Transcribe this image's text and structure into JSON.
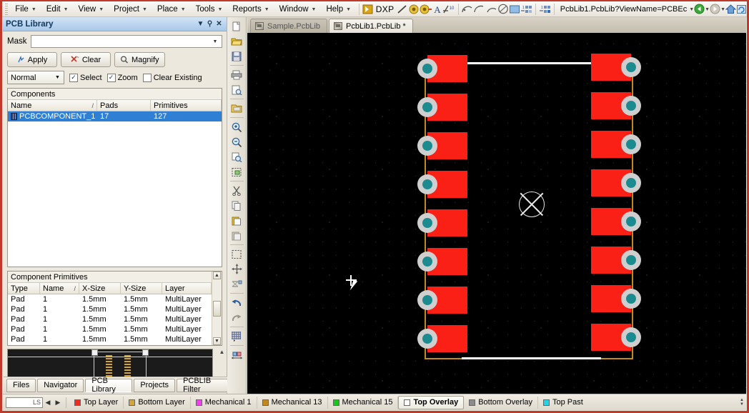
{
  "menu": {
    "items": [
      {
        "label": "File",
        "accel": "F"
      },
      {
        "label": "Edit",
        "accel": "E"
      },
      {
        "label": "View",
        "accel": "V"
      },
      {
        "label": "Project",
        "accel": "j"
      },
      {
        "label": "Place",
        "accel": "P"
      },
      {
        "label": "Tools",
        "accel": "T"
      },
      {
        "label": "Reports",
        "accel": "R"
      },
      {
        "label": "Window",
        "accel": "W"
      },
      {
        "label": "Help",
        "accel": "H"
      }
    ],
    "dxp_label": "DXP",
    "address": "PcbLib1.PcbLib?ViewName=PCBEc",
    "toolbar_icons": [
      "dxp-menu-icon",
      "line-icon",
      "pad-icon",
      "via-icon",
      "string-icon",
      "coordinate-icon",
      "arc-center-icon",
      "arc-edge-icon",
      "arc-any-icon",
      "full-circle-icon",
      "fill-icon",
      "component-body-icon",
      "dimension-icon"
    ],
    "nav_icons": [
      "back-icon",
      "forward-icon",
      "home-icon",
      "refresh-icon"
    ]
  },
  "panel": {
    "title": "PCB Library",
    "title_buttons": [
      "chevron-down-icon",
      "pin-icon",
      "close-icon"
    ],
    "mask_label": "Mask",
    "mask_value": "",
    "buttons": [
      {
        "label": "Apply",
        "icon": "apply-icon"
      },
      {
        "label": "Clear",
        "icon": "clear-icon"
      },
      {
        "label": "Magnify",
        "icon": "magnify-icon"
      }
    ],
    "select_mode": "Normal",
    "checkboxes": [
      {
        "label": "Select",
        "checked": true
      },
      {
        "label": "Zoom",
        "checked": true
      },
      {
        "label": "Clear Existing",
        "checked": false
      }
    ],
    "components": {
      "caption": "Components",
      "columns": [
        "Name",
        "Pads",
        "Primitives"
      ],
      "sorted_column": "Name",
      "rows": [
        {
          "name": "PCBCOMPONENT_1",
          "pads": "17",
          "primitives": "127",
          "selected": true
        }
      ]
    },
    "primitives": {
      "caption": "Component Primitives",
      "columns": [
        "Type",
        "Name",
        "X-Size",
        "Y-Size",
        "Layer"
      ],
      "sorted_column": "Name",
      "rows": [
        {
          "type": "Pad",
          "name": "1",
          "x_size": "1.5mm",
          "y_size": "1.5mm",
          "layer": "MultiLayer"
        },
        {
          "type": "Pad",
          "name": "1",
          "x_size": "1.5mm",
          "y_size": "1.5mm",
          "layer": "MultiLayer"
        },
        {
          "type": "Pad",
          "name": "1",
          "x_size": "1.5mm",
          "y_size": "1.5mm",
          "layer": "MultiLayer"
        },
        {
          "type": "Pad",
          "name": "1",
          "x_size": "1.5mm",
          "y_size": "1.5mm",
          "layer": "MultiLayer"
        },
        {
          "type": "Pad",
          "name": "1",
          "x_size": "1.5mm",
          "y_size": "1.5mm",
          "layer": "MultiLayer"
        }
      ]
    },
    "tabs": [
      {
        "label": "Files",
        "active": false
      },
      {
        "label": "Navigator",
        "active": false
      },
      {
        "label": "PCB Library",
        "active": true
      },
      {
        "label": "Projects",
        "active": false
      },
      {
        "label": "PCBLIB Filter",
        "active": false
      }
    ]
  },
  "vertical_toolbar": {
    "icons": [
      "new-icon",
      "open-folder-icon",
      "save-icon",
      "print-icon",
      "print-preview-icon",
      "open-project-icon",
      "zoom-in-icon",
      "zoom-out-icon",
      "zoom-area-icon",
      "zoom-selected-icon",
      "cut-icon",
      "copy-icon",
      "paste-icon",
      "paste-special-icon",
      "rubber-stamp-icon",
      "move-icon",
      "swap-icon",
      "undo-icon",
      "redo-icon",
      "grid-icon",
      "dimension-tool-icon"
    ]
  },
  "editor": {
    "document_tabs": [
      {
        "label": "Sample.PcbLib",
        "active": false,
        "modified": false
      },
      {
        "label": "PcbLib1.PcbLib *",
        "active": true,
        "modified": true
      }
    ]
  },
  "canvas": {
    "background": "#000000",
    "pad_fill": "#fb2016",
    "pad_ring": "#cfcfcf",
    "pad_hole": "#1c8b90",
    "silkscreen": "#ffffff",
    "courtyard": "#c08a1e",
    "origin_marker": "origin-cross-circle-icon",
    "cursor": "crosshair-arrow-cursor",
    "left_pads": 8,
    "right_pads": 8
  },
  "statusbar": {
    "ls_label": "LS",
    "nav_prev": "prev-layer-icon",
    "nav_next": "next-layer-icon",
    "layers": [
      {
        "label": "Top Layer",
        "color": "#f42a1e",
        "active": false
      },
      {
        "label": "Bottom Layer",
        "color": "#d2a63c",
        "active": false
      },
      {
        "label": "Mechanical 1",
        "color": "#f23df0",
        "active": false
      },
      {
        "label": "Mechanical 13",
        "color": "#c08a1e",
        "active": false
      },
      {
        "label": "Mechanical 15",
        "color": "#16c916",
        "active": false
      },
      {
        "label": "Top Overlay",
        "color": "#ffffff",
        "active": true
      },
      {
        "label": "Bottom Overlay",
        "color": "#8c8c8c",
        "active": false
      },
      {
        "label": "Top Past",
        "color": "#23d3e8",
        "active": false
      }
    ]
  }
}
